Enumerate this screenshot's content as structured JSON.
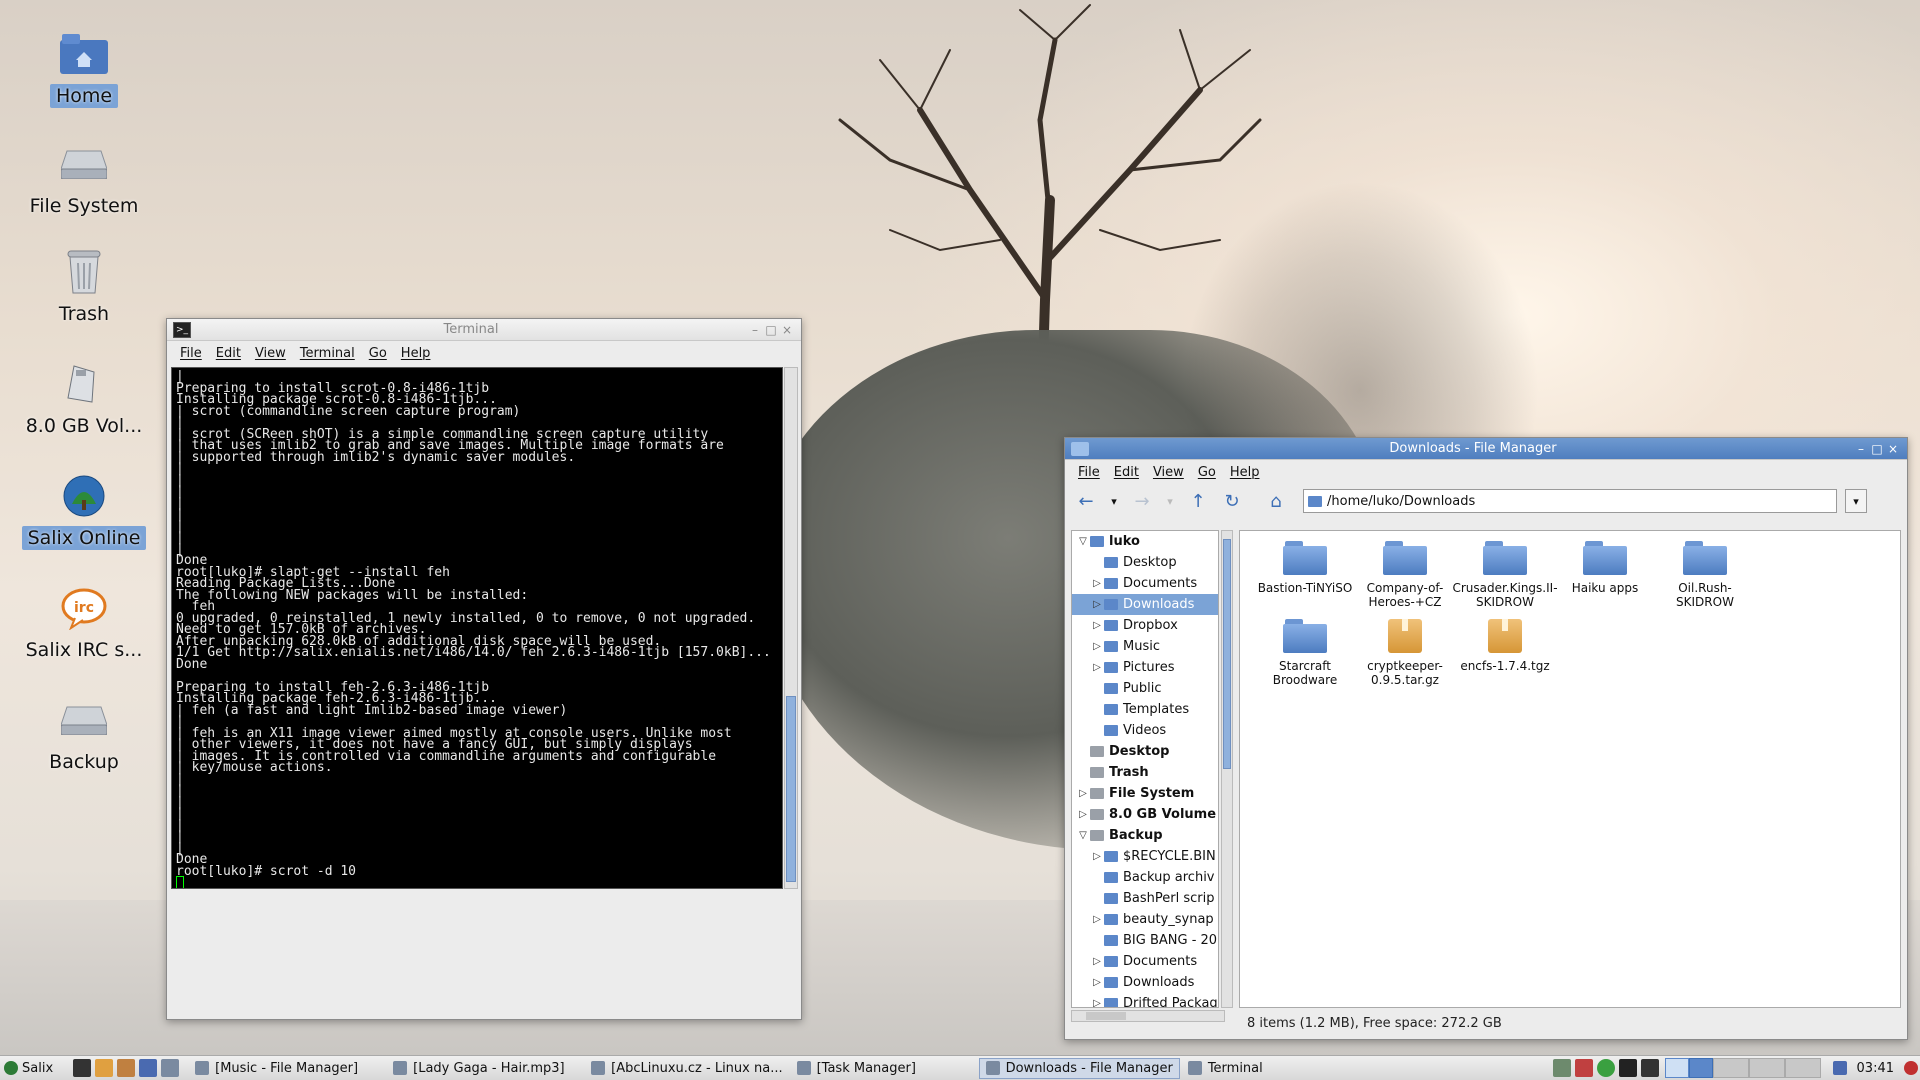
{
  "desktop": {
    "icons": [
      {
        "label": "Home",
        "icon": "home-folder-icon"
      },
      {
        "label": "File System",
        "icon": "drive-icon"
      },
      {
        "label": "Trash",
        "icon": "trash-icon"
      },
      {
        "label": "8.0 GB Vol...",
        "icon": "usb-drive-icon"
      },
      {
        "label": "Salix Online",
        "icon": "salix-icon"
      },
      {
        "label": "Salix IRC s...",
        "icon": "irc-icon"
      },
      {
        "label": "Backup",
        "icon": "drive-icon"
      }
    ]
  },
  "terminal": {
    "title": "Terminal",
    "menu": [
      "File",
      "Edit",
      "View",
      "Terminal",
      "Go",
      "Help"
    ],
    "lines": [
      "|",
      "Preparing to install scrot-0.8-i486-1tjb",
      "Installing package scrot-0.8-i486-1tjb...",
      "| scrot (commandline screen capture program)",
      "|",
      "| scrot (SCReen shOT) is a simple commandline screen capture utility",
      "| that uses imlib2 to grab and save images. Multiple image formats are",
      "| supported through imlib2's dynamic saver modules.",
      "|",
      "|",
      "|",
      "|",
      "|",
      "|",
      "|",
      "|",
      "Done",
      "root[luko]# slapt-get --install feh",
      "Reading Package Lists...Done",
      "The following NEW packages will be installed:",
      "  feh",
      "0 upgraded, 0 reinstalled, 1 newly installed, 0 to remove, 0 not upgraded.",
      "Need to get 157.0kB of archives.",
      "After unpacking 628.0kB of additional disk space will be used.",
      "1/1 Get http://salix.enialis.net/i486/14.0/ feh 2.6.3-i486-1tjb [157.0kB]...",
      "Done",
      "",
      "Preparing to install feh-2.6.3-i486-1tjb",
      "Installing package feh-2.6.3-i486-1tjb...",
      "| feh (a fast and light Imlib2-based image viewer)",
      "|",
      "| feh is an X11 image viewer aimed mostly at console users. Unlike most",
      "| other viewers, it does not have a fancy GUI, but simply displays",
      "| images. It is controlled via commandline arguments and configurable",
      "| key/mouse actions.",
      "|",
      "|",
      "|",
      "|",
      "|",
      "|",
      "|",
      "Done",
      "root[luko]# scrot -d 10"
    ]
  },
  "filemanager": {
    "title": "Downloads - File Manager",
    "menu": [
      "File",
      "Edit",
      "View",
      "Go",
      "Help"
    ],
    "path": "/home/luko/Downloads",
    "tree": [
      {
        "label": "luko",
        "level": 0,
        "expander": "open",
        "bold": true
      },
      {
        "label": "Desktop",
        "level": 1,
        "expander": ""
      },
      {
        "label": "Documents",
        "level": 1,
        "expander": "closed"
      },
      {
        "label": "Downloads",
        "level": 1,
        "expander": "closed",
        "selected": true
      },
      {
        "label": "Dropbox",
        "level": 1,
        "expander": "closed"
      },
      {
        "label": "Music",
        "level": 1,
        "expander": "closed"
      },
      {
        "label": "Pictures",
        "level": 1,
        "expander": "closed"
      },
      {
        "label": "Public",
        "level": 1,
        "expander": ""
      },
      {
        "label": "Templates",
        "level": 1,
        "expander": ""
      },
      {
        "label": "Videos",
        "level": 1,
        "expander": ""
      },
      {
        "label": "Desktop",
        "level": 0,
        "expander": "",
        "bold": true
      },
      {
        "label": "Trash",
        "level": 0,
        "expander": "",
        "bold": true
      },
      {
        "label": "File System",
        "level": 0,
        "expander": "closed",
        "bold": true
      },
      {
        "label": "8.0 GB Volume",
        "level": 0,
        "expander": "closed",
        "bold": true
      },
      {
        "label": "Backup",
        "level": 0,
        "expander": "open",
        "bold": true
      },
      {
        "label": "$RECYCLE.BIN",
        "level": 1,
        "expander": "closed"
      },
      {
        "label": "Backup archiv",
        "level": 1,
        "expander": ""
      },
      {
        "label": "BashPerl scrip",
        "level": 1,
        "expander": ""
      },
      {
        "label": "beauty_synap",
        "level": 1,
        "expander": "closed"
      },
      {
        "label": "BIG BANG - 20",
        "level": 1,
        "expander": ""
      },
      {
        "label": "Documents",
        "level": 1,
        "expander": "closed"
      },
      {
        "label": "Downloads",
        "level": 1,
        "expander": "closed"
      },
      {
        "label": "Drifted Packag",
        "level": 1,
        "expander": "closed"
      }
    ],
    "files": [
      {
        "name": "Bastion-TiNYiSO",
        "type": "folder"
      },
      {
        "name": "Company-of-Heroes-+CZ",
        "type": "folder"
      },
      {
        "name": "Crusader.Kings.II-SKIDROW",
        "type": "folder"
      },
      {
        "name": "Haiku apps",
        "type": "folder"
      },
      {
        "name": "Oil.Rush-SKIDROW",
        "type": "folder"
      },
      {
        "name": "Starcraft Broodware",
        "type": "folder"
      },
      {
        "name": "cryptkeeper-0.9.5.tar.gz",
        "type": "archive"
      },
      {
        "name": "encfs-1.7.4.tgz",
        "type": "archive"
      }
    ],
    "status": "8 items (1.2 MB), Free space: 272.2 GB"
  },
  "taskbar": {
    "start_label": "Salix",
    "tasks": [
      {
        "label": "[Music - File Manager]",
        "active": false
      },
      {
        "label": "[Lady Gaga - Hair.mp3]",
        "active": false
      },
      {
        "label": "[AbcLinuxu.cz - Linux na...",
        "active": false
      },
      {
        "label": "[Task Manager]",
        "active": false
      },
      {
        "label": "Downloads - File Manager",
        "active": true
      },
      {
        "label": "Terminal",
        "active": false
      }
    ],
    "clock": "03:41"
  },
  "colors": {
    "accent": "#7ba3d6",
    "titlebar_active": "#5a88c6",
    "terminal_bg": "#000000"
  }
}
